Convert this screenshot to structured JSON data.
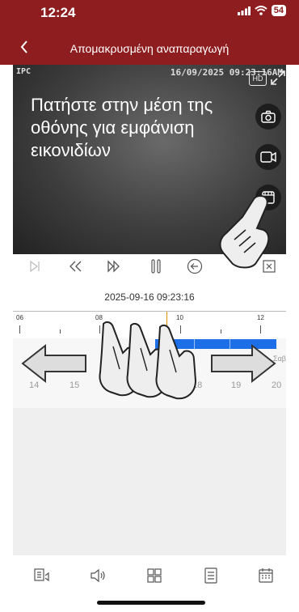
{
  "status": {
    "time": "12:24",
    "battery": "54"
  },
  "nav": {
    "title": "Απομακρυσμένη αναπαραγωγή"
  },
  "video": {
    "osd_channel": "IPC",
    "osd_timestamp": "16/09/2025 09:23:16AM",
    "hd_label": "HD",
    "instruction": "Πατήστε στην μέση της οθόνης για εμφάνιση εικονιδίων"
  },
  "playback": {
    "current_datetime": "2025-09-16 09:23:16"
  },
  "timeline": {
    "hours": [
      "06",
      "08",
      "10",
      "12"
    ],
    "days": [
      "14",
      "15",
      "16",
      "17",
      "18",
      "19",
      "20"
    ],
    "weekday_label": "Σαβ"
  },
  "colors": {
    "header": "#8e1d1f",
    "record": "#1c6fe6",
    "cursor": "#e39200"
  }
}
